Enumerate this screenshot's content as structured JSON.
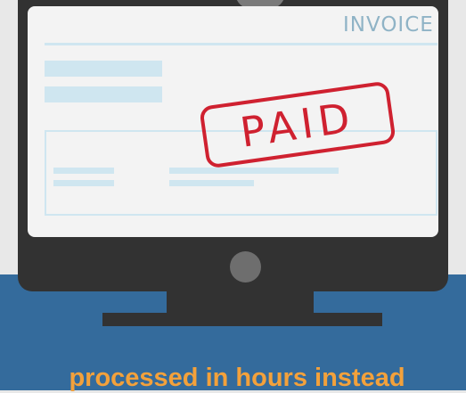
{
  "illustration": {
    "invoice_heading": "INVOICE",
    "stamp_text": "PAID",
    "icons": [
      "monitor-icon",
      "invoice-document-icon",
      "paid-stamp-icon"
    ]
  },
  "caption": "processed in hours instead",
  "colors": {
    "background_top": "#e8e8e8",
    "background_bottom": "#346b9c",
    "monitor": "#323232",
    "screen": "#f3f3f3",
    "invoice_lines": "#cfe6f0",
    "heading": "#8fb3c6",
    "stamp": "#cf2130",
    "caption": "#f3a13b"
  }
}
